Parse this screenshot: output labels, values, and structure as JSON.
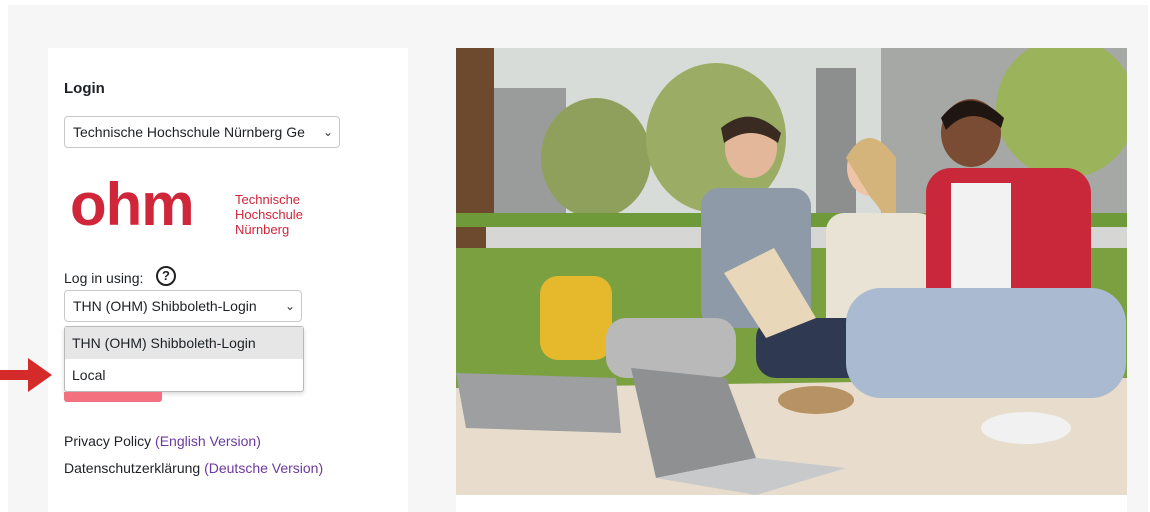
{
  "login": {
    "title": "Login",
    "organization_select": {
      "value": "Technische Hochschule Nürnberg Ge",
      "chevron_icon": "chevron-down-icon"
    },
    "logo": {
      "word": "ohm",
      "lines": [
        "Technische",
        "Hochschule",
        "Nürnberg"
      ],
      "color": "#d0263a"
    },
    "login_using_label": "Log in using:",
    "help_icon": "help-icon",
    "help_glyph": "?",
    "method_select": {
      "value": "THN (OHM) Shibboleth-Login",
      "options": [
        "THN (OHM) Shibboleth-Login",
        "Local"
      ]
    },
    "login_button_color": "#f3707f"
  },
  "footer_links": {
    "privacy_text": "Privacy Policy",
    "privacy_link": "(English Version)",
    "datenschutz_text": "Datenschutzerklärung",
    "datenschutz_link": "(Deutsche Version)",
    "link_color": "#6b3aa0"
  },
  "annotation": {
    "arrow_color": "#d42a2a"
  }
}
